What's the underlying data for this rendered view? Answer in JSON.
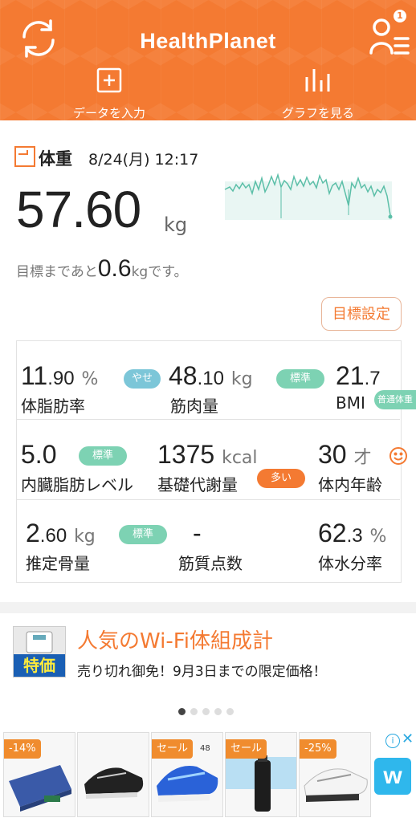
{
  "header": {
    "title": "HealthPlanet",
    "notification_count": "1",
    "input_label": "データを入力",
    "graph_label": "グラフを見る",
    "accent_color": "#f47a32"
  },
  "weight": {
    "label": "体重",
    "datetime": "8/24(月) 12:17",
    "value": "57.60",
    "unit": "kg",
    "goal_prefix": "目標まであと",
    "goal_value": "0.6",
    "goal_suffix": "kgです。",
    "goal_button": "目標設定"
  },
  "metrics": [
    {
      "value": "11",
      "decimal": ".90",
      "unit": "%",
      "name": "体脂肪率",
      "tag": "やせ"
    },
    {
      "value": "48",
      "decimal": ".10",
      "unit": "kg",
      "name": "筋肉量",
      "tag": "標準"
    },
    {
      "value": "21",
      "decimal": ".7",
      "unit": "",
      "name": "BMI",
      "tag": "普通体重"
    },
    {
      "value": "5.0",
      "decimal": "",
      "unit": "",
      "name": "内臓脂肪レベル",
      "tag": "標準"
    },
    {
      "value": "1375",
      "decimal": "",
      "unit": "kcal",
      "name": "基礎代謝量",
      "tag": "多い"
    },
    {
      "value": "30",
      "decimal": "",
      "unit": "才",
      "name": "体内年齢",
      "tag": ""
    },
    {
      "value": "2",
      "decimal": ".60",
      "unit": "kg",
      "name": "推定骨量",
      "tag": "標準"
    },
    {
      "value": "-",
      "decimal": "",
      "unit": "",
      "name": "筋質点数",
      "tag": ""
    },
    {
      "value": "62",
      "decimal": ".3",
      "unit": "%",
      "name": "体水分率",
      "tag": ""
    }
  ],
  "banner": {
    "image_label": "特価",
    "title": "人気のWi-Fi体組成計",
    "subtitle": "売り切れ御免！9月3日までの限定価格！"
  },
  "ads": {
    "tags": [
      "-14%",
      "",
      "セール",
      "セール",
      "-25%"
    ],
    "extra_label": "48",
    "brand_letter": "w"
  }
}
